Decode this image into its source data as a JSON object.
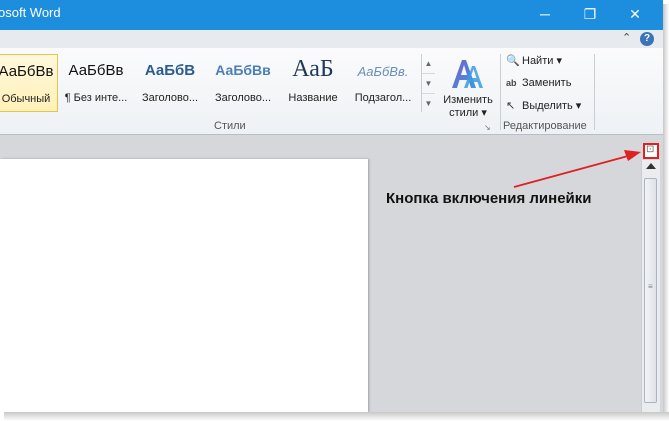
{
  "window": {
    "title": "osoft Word",
    "minimize_glyph": "─",
    "restore_glyph": "❐",
    "close_glyph": "✕"
  },
  "tabrow": {
    "collapse_glyph": "⌃",
    "help_glyph": "?"
  },
  "styles_gallery": {
    "items": [
      {
        "sample": "АаБбВв",
        "name": "Обычный",
        "selected": true
      },
      {
        "sample": "АаБбВв",
        "name": "¶ Без инте..."
      },
      {
        "sample": "АаБбВ",
        "name": "Заголово..."
      },
      {
        "sample": "АаБбВв",
        "name": "Заголово..."
      },
      {
        "sample": "АаБ",
        "name": "Название"
      },
      {
        "sample": "АаБбВв.",
        "name": "Подзагол..."
      }
    ],
    "group_label": "Стили"
  },
  "change_styles": {
    "line1": "Изменить",
    "line2": "стили ▾"
  },
  "editing": {
    "find": "Найти ▾",
    "replace": "Заменить",
    "select": "Выделить ▾",
    "group_label": "Редактирование"
  },
  "annotation": {
    "text": "Кнопка включения линейки"
  },
  "colors": {
    "titlebar": "#1d8ddd",
    "annotation_arrow": "#e02020",
    "selected_style": "#fff1b8"
  },
  "icons": {
    "ruler_toggle": "ruler-toggle-icon",
    "find": "binoculars-icon",
    "replace": "replace-icon",
    "select": "cursor-icon"
  }
}
